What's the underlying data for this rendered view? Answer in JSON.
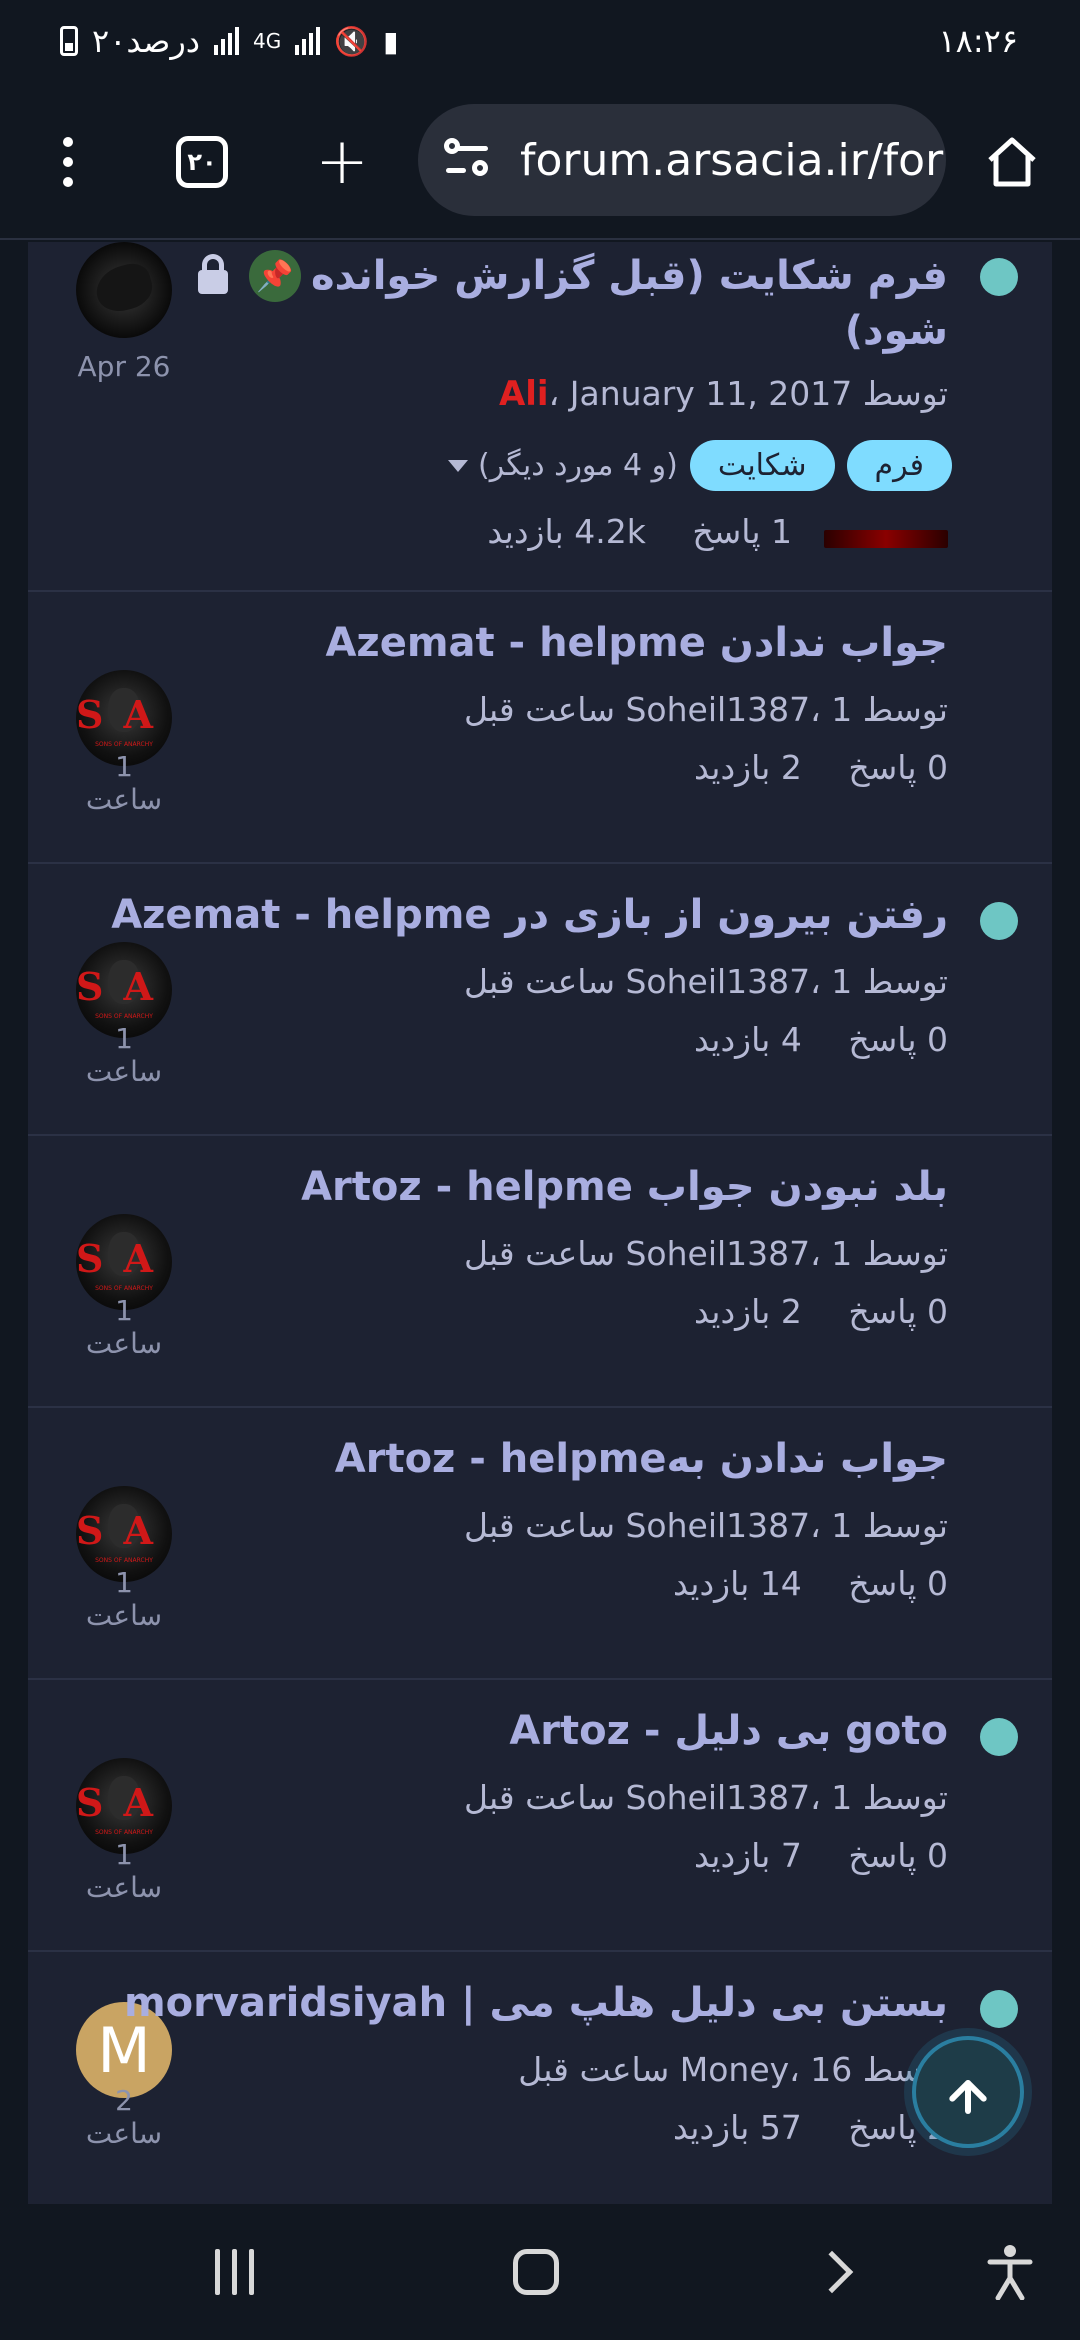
{
  "status_bar": {
    "time": "۱۸:۲۶",
    "battery_text": "۲۰درصد",
    "network": "4G"
  },
  "browser": {
    "url": "forum.arsacia.ir/foru",
    "tab_count": "۲۰"
  },
  "topics": [
    {
      "title_line1": "فرم شکایت (قبل گزارش خوانده",
      "title_line2": "شود)",
      "author_prefix": "توسط",
      "author": "Ali",
      "date": "January 11, 2017",
      "tags": [
        "فرم",
        "شکایت"
      ],
      "more_tags": "(و 4 مورد دیگر)",
      "replies": "1 پاسخ",
      "views": "4.2k بازدید",
      "last_time": "Apr 26",
      "unread": true,
      "pinned": true,
      "locked": true
    },
    {
      "title": "جواب ندادن Azemat - helpme",
      "meta": "توسط Soheil1387، 1 ساعت قبل",
      "replies": "0 پاسخ",
      "views": "2 بازدید",
      "last_time": "1 ساعت",
      "unread": false
    },
    {
      "title": "رفتن بیرون از بازی در Azemat - helpme",
      "meta": "توسط Soheil1387، 1 ساعت قبل",
      "replies": "0 پاسخ",
      "views": "4 بازدید",
      "last_time": "1 ساعت",
      "unread": true
    },
    {
      "title": "بلد نبودن جواب Artoz - helpme",
      "meta": "توسط Soheil1387، 1 ساعت قبل",
      "replies": "0 پاسخ",
      "views": "2 بازدید",
      "last_time": "1 ساعت",
      "unread": false
    },
    {
      "title": "جواب ندادن بهArtoz - helpme",
      "meta": "توسط Soheil1387، 1 ساعت قبل",
      "replies": "0 پاسخ",
      "views": "14 بازدید",
      "last_time": "1 ساعت",
      "unread": false
    },
    {
      "title": "goto بی دلیل - Artoz",
      "meta": "توسط Soheil1387، 1 ساعت قبل",
      "replies": "0 پاسخ",
      "views": "7 بازدید",
      "last_time": "1 ساعت",
      "unread": true
    },
    {
      "title": "بستن بی دلیل هلپ می | morvaridsiyah",
      "meta": "توسط Money، 16 ساعت قبل",
      "replies": "2 پاسخ",
      "views": "57 بازدید",
      "last_time": "2 ساعت",
      "avatar_letter": "M",
      "unread": true
    }
  ],
  "colors": {
    "background": "#111720",
    "panel": "#1d2232",
    "title": "#a9aee0",
    "unread_dot": "#6ec6c4",
    "tag": "#7fdcff"
  }
}
